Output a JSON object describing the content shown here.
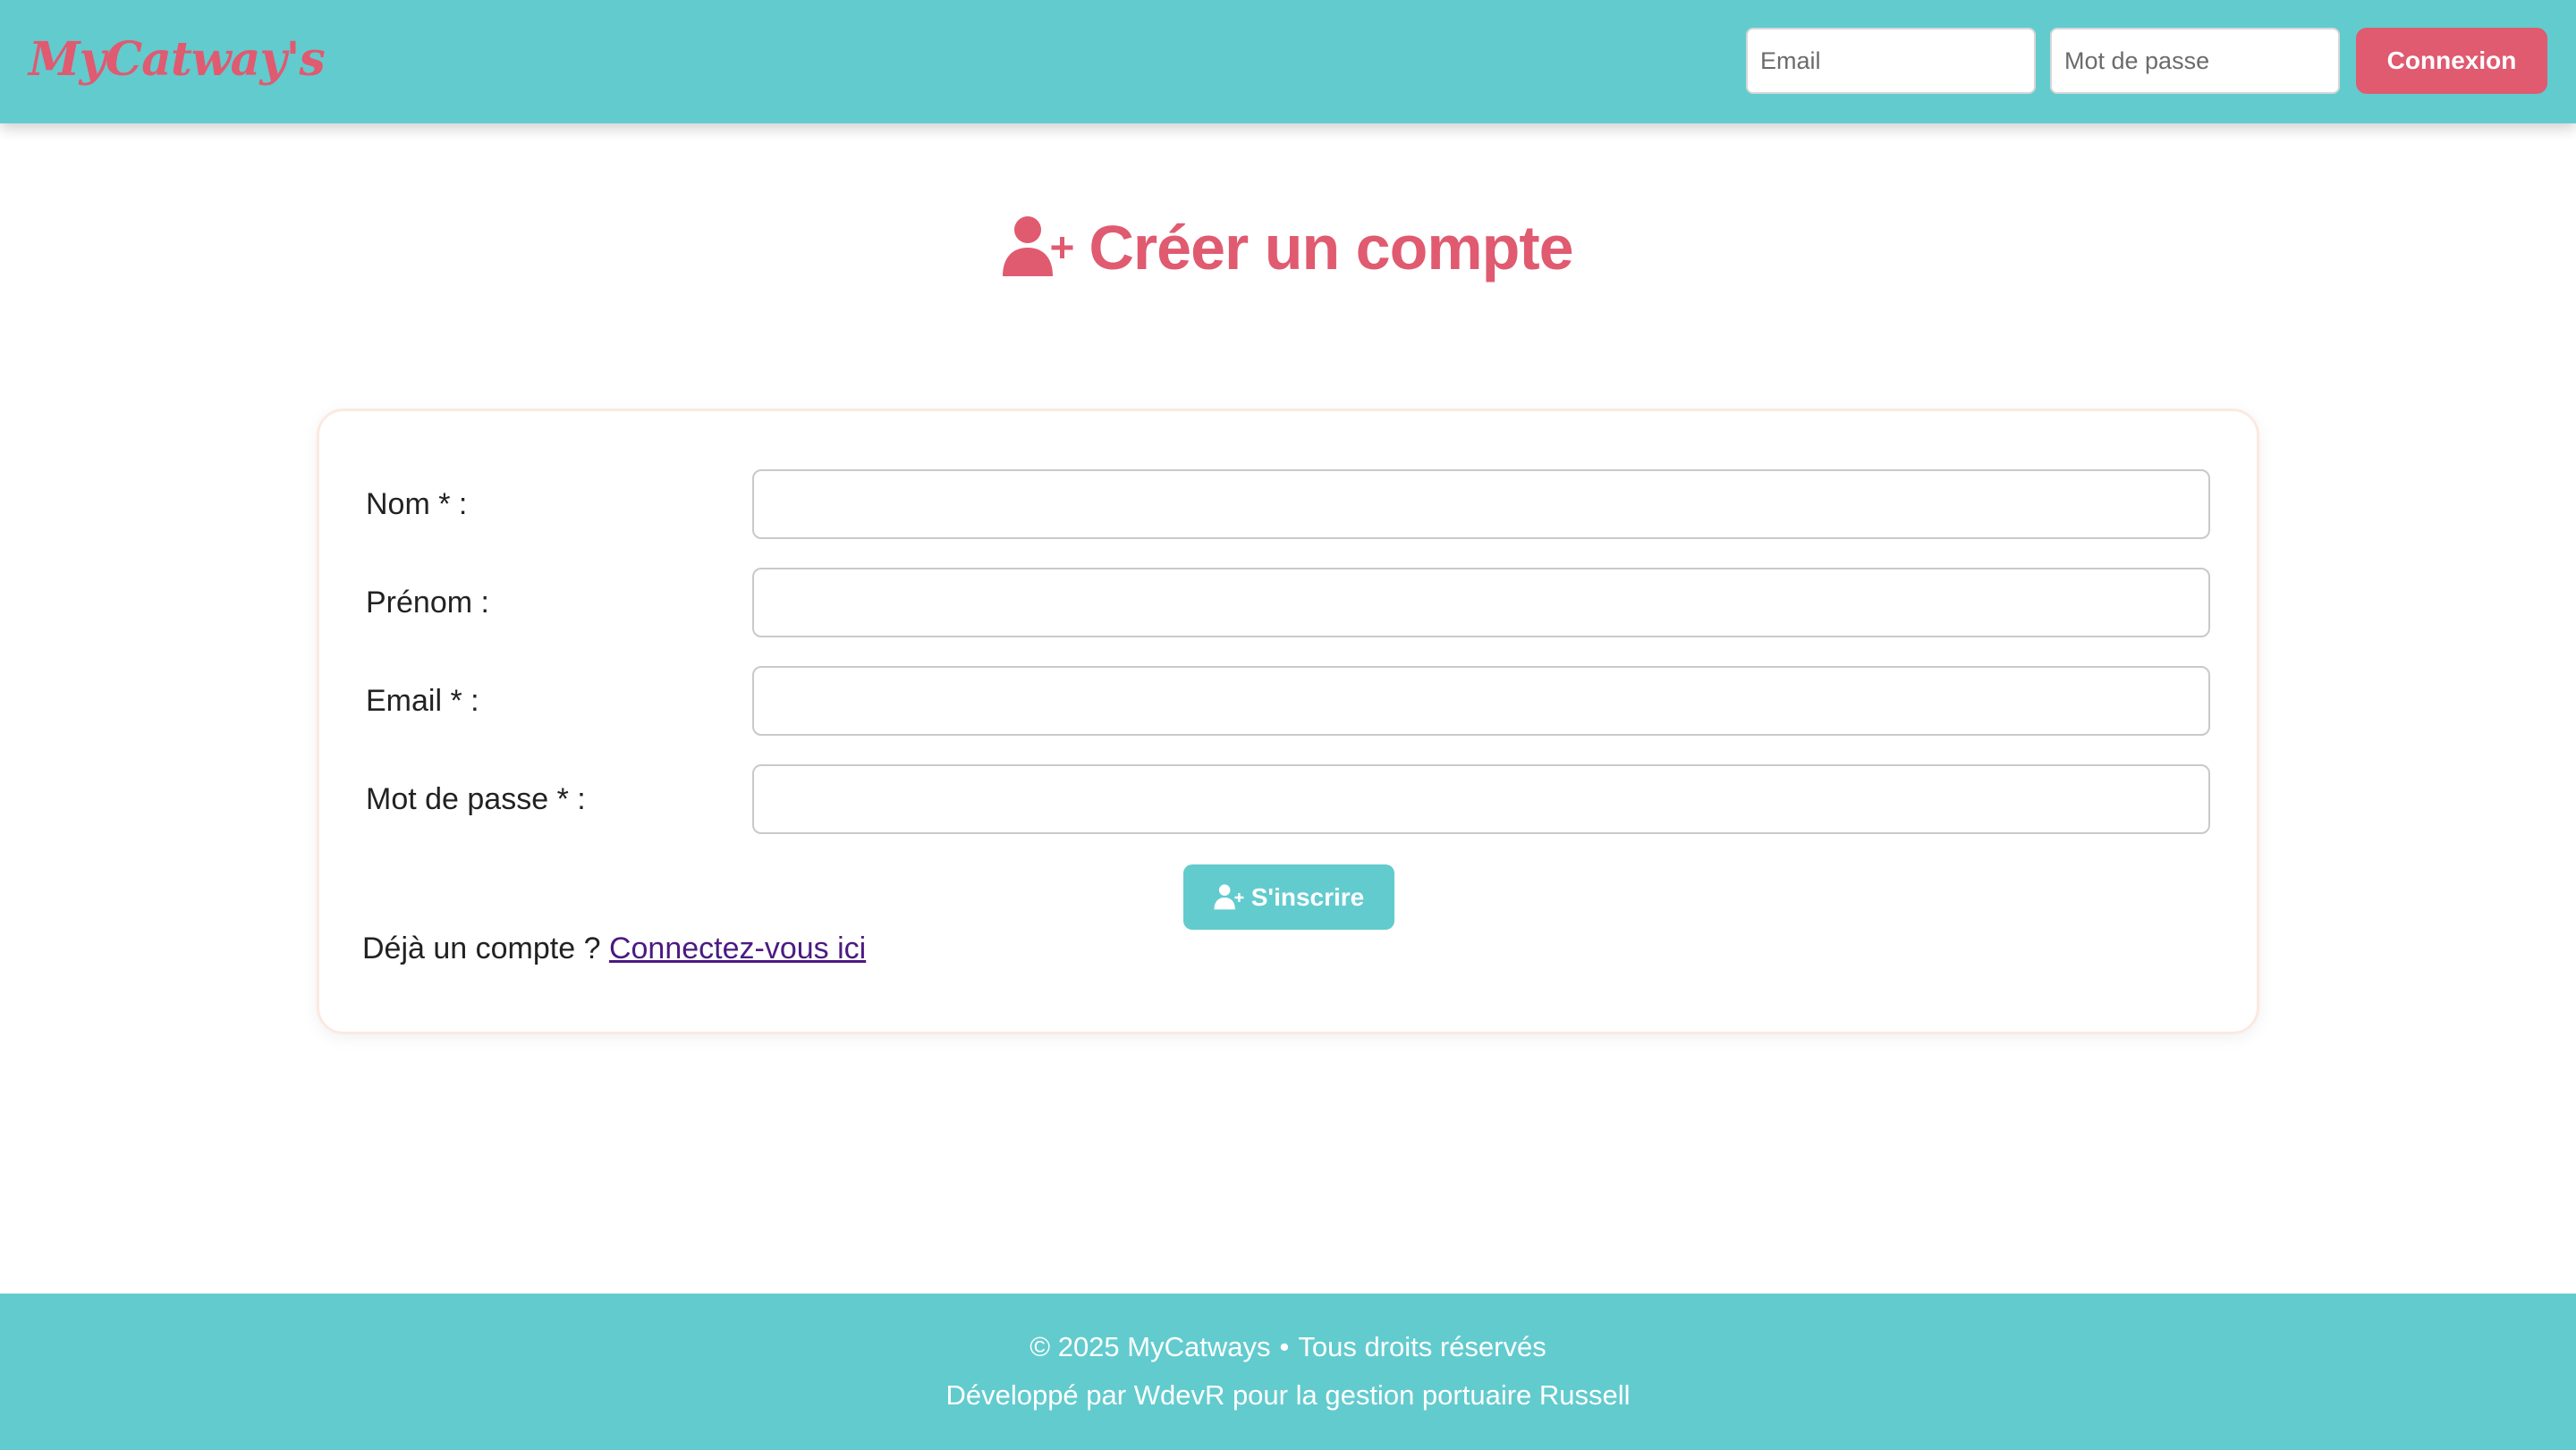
{
  "header": {
    "brand": "MyCatway's",
    "email_placeholder": "Email",
    "password_placeholder": "Mot de passe",
    "login_button": "Connexion"
  },
  "page": {
    "title": "Créer un compte",
    "title_icon": "user-plus-icon"
  },
  "form": {
    "fields": [
      {
        "label": "Nom * :",
        "value": ""
      },
      {
        "label": "Prénom :",
        "value": ""
      },
      {
        "label": "Email * :",
        "value": ""
      },
      {
        "label": "Mot de passe * :",
        "value": ""
      }
    ],
    "submit_label": "S'inscrire",
    "submit_icon": "user-plus-icon",
    "already_text": "Déjà un compte ?",
    "login_link": "Connectez-vous ici"
  },
  "footer": {
    "copyright": "© 2025 MyCatways",
    "separator": "•",
    "rights": "Tous droits réservés",
    "credit": "Développé par WdevR pour la gestion portuaire Russell"
  },
  "colors": {
    "teal": "#62cbce",
    "pink": "#e05a70",
    "link": "#4b1a82"
  }
}
